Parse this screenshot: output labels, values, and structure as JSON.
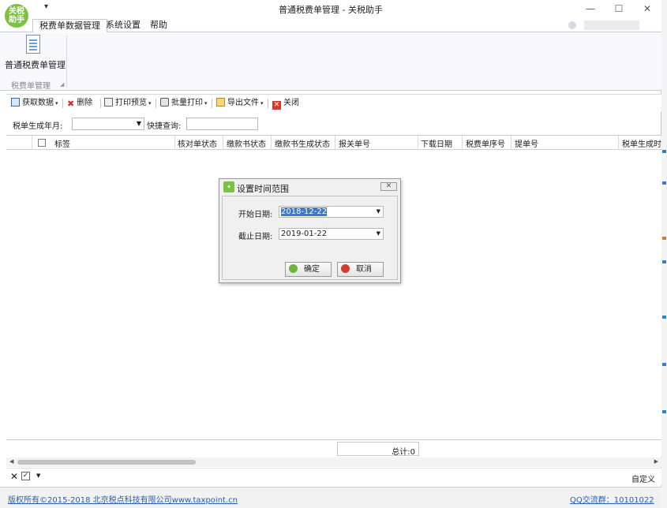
{
  "app": {
    "logo_line1": "关税",
    "logo_line2": "助手",
    "window_title": "普通税费单管理 - 关税助手",
    "qat_glyph": "▾",
    "minimize": "—",
    "maximize": "☐",
    "close": "✕"
  },
  "tabs": [
    {
      "label": "税费单数据管理",
      "active": true
    },
    {
      "label": "系统设置",
      "active": false
    },
    {
      "label": "帮助",
      "active": false
    }
  ],
  "ribbon": {
    "button_label": "普通税费单管理",
    "group_label": "税费单管理"
  },
  "toolbar": {
    "fetch": "获取数据",
    "delete": "删除",
    "preview": "打印预览",
    "batch_print": "批量打印",
    "export": "导出文件",
    "close": "关闭"
  },
  "filter": {
    "month_label": "税单生成年月:",
    "month_value": "",
    "quick_label": "快捷查询:",
    "quick_value": ""
  },
  "grid": {
    "columns": [
      "标签",
      "核对单状态",
      "缴款书状态",
      "缴款书生成状态",
      "报关单号",
      "下载日期",
      "税费单序号",
      "提单号",
      "税单生成时"
    ],
    "rows": []
  },
  "summary": {
    "total": "总计:0"
  },
  "footer": {
    "custom": "自定义"
  },
  "status": {
    "copyright": "版权所有©2015-2018 北京税点科技有限公司www.taxpoint.cn",
    "qq": "QQ交流群：10101022"
  },
  "dialog": {
    "title": "设置时间范围",
    "start_label": "开始日期:",
    "start_value": "2018-12-22",
    "end_label": "截止日期:",
    "end_value": "2019-01-22",
    "ok": "确定",
    "cancel": "取消",
    "close_glyph": "✕"
  },
  "colors": {
    "accent": "#7cc242",
    "selection": "#3b78d4",
    "link": "#2a5db0"
  }
}
